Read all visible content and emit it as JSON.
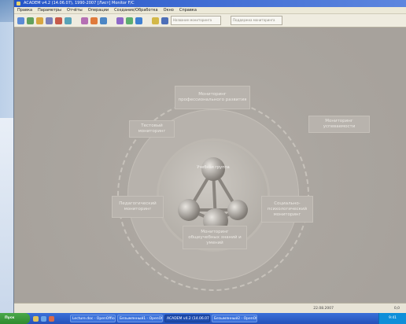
{
  "window": {
    "title": "ACADEM v4.2 (14.06.07), 1990-2007 [Лист] Monitor F/C"
  },
  "menu": [
    "Правка",
    "Параметры",
    "Отчёты",
    "Операции",
    "Создание/Обработка",
    "Окно",
    "Справка"
  ],
  "toolbar": {
    "search_placeholder": "Название мониторинга",
    "filter_placeholder": "Поддержка мониторинга"
  },
  "diagram": {
    "center_label": "Учебная группа",
    "nodes": [
      "Мониторинг профессионального развития",
      "Мониторинг успеваемости",
      "Социально-психологический мониторинг",
      "Мониторинг общеучебных знаний и умений",
      "Педагогический мониторинг",
      "Тестовый мониторинг"
    ]
  },
  "status": {
    "date": "22.08.2007",
    "cell": "0,0"
  },
  "taskbar": {
    "start_label": "Пуск",
    "tasks": [
      "Lecture.doc - OpenOffice",
      "Безымянный1 - OpenOf...",
      "ACADEM v4.2 (14.06.07)...",
      "Безымянный2 - OpenOf..."
    ],
    "clock": "9:41"
  },
  "colors": {
    "content_bg": "#a9a49e",
    "node_bg": "#b8b3ad",
    "taskbar": "#2552bb"
  }
}
